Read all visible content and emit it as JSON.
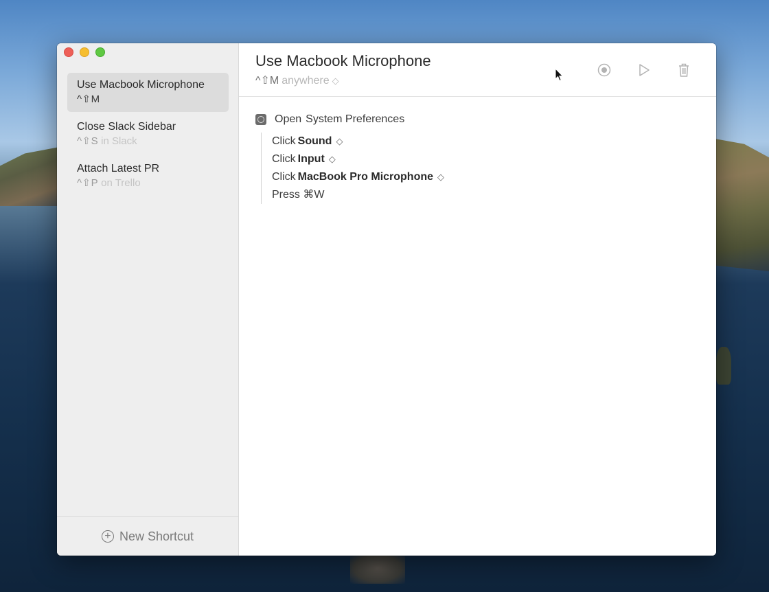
{
  "sidebar": {
    "items": [
      {
        "title": "Use Macbook Microphone",
        "keys": "^⇧M",
        "context": ""
      },
      {
        "title": "Close Slack Sidebar",
        "keys": "^⇧S",
        "context": "in Slack"
      },
      {
        "title": "Attach Latest PR",
        "keys": "^⇧P",
        "context": "on Trello"
      }
    ],
    "new_shortcut_label": "New Shortcut",
    "selected_index": 0
  },
  "main": {
    "title": "Use Macbook Microphone",
    "keys": "^⇧M",
    "context": "anywhere",
    "steps": {
      "open": {
        "verb": "Open",
        "target": "System Preferences"
      },
      "nested": [
        {
          "verb": "Click",
          "target": "Sound"
        },
        {
          "verb": "Click",
          "target": "Input"
        },
        {
          "verb": "Click",
          "target": "MacBook Pro Microphone"
        }
      ],
      "press": {
        "verb": "Press",
        "target": "⌘W"
      }
    }
  },
  "icons": {
    "record": "record-icon",
    "play": "play-icon",
    "trash": "trash-icon",
    "plus": "plus-circle-icon",
    "app": "system-preferences-icon"
  },
  "colors": {
    "close": "#ee5f57",
    "minimize": "#f6be2f",
    "maximize": "#5fc842",
    "selected_row": "#dcdcdc"
  }
}
